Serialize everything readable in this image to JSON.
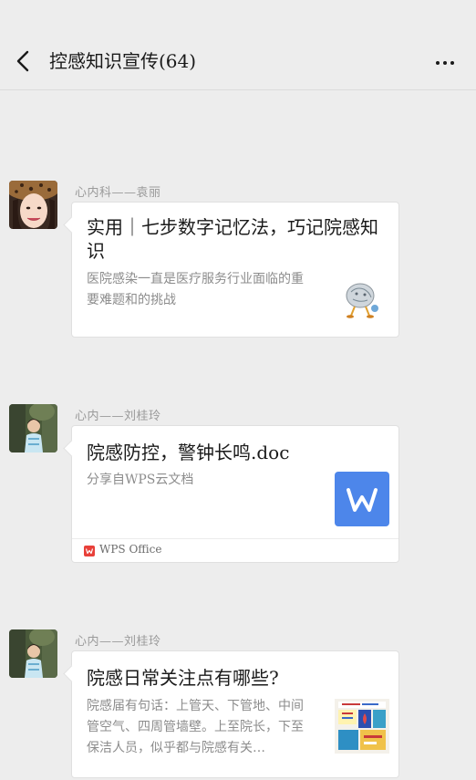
{
  "nav": {
    "title": "控感知识宣传(64)",
    "back_icon": "chevron-left-icon",
    "more_icon": "more-dots-icon"
  },
  "messages": [
    {
      "sender": "心内科——袁丽",
      "avatar": "avatar-woman-leopard-hat",
      "card": {
        "title": "实用｜七步数字记忆法，巧记院感知识",
        "description": "医院感染一直是医疗服务行业面临的重要难题和的挑战",
        "thumbnail": "cartoon-illustration"
      }
    },
    {
      "sender": "心内——刘桂玲",
      "avatar": "avatar-person-outdoor",
      "card": {
        "title": "院感防控，警钟长鸣.doc",
        "description": "分享自WPS云文档",
        "thumbnail": "wps-document-icon",
        "footer": "WPS  Office"
      }
    },
    {
      "sender": "心内——刘桂玲",
      "avatar": "avatar-person-outdoor",
      "card": {
        "title": "院感日常关注点有哪些?",
        "description": "院感届有句话：上管天、下管地、中间管空气、四周管墙壁。上至院长，下至保洁人员，似乎都与院感有关…",
        "thumbnail": "poster-thumbnail"
      }
    }
  ],
  "colors": {
    "background": "#ededed",
    "card": "#ffffff",
    "wps_blue": "#4d86ea",
    "wps_red": "#e8403a"
  }
}
